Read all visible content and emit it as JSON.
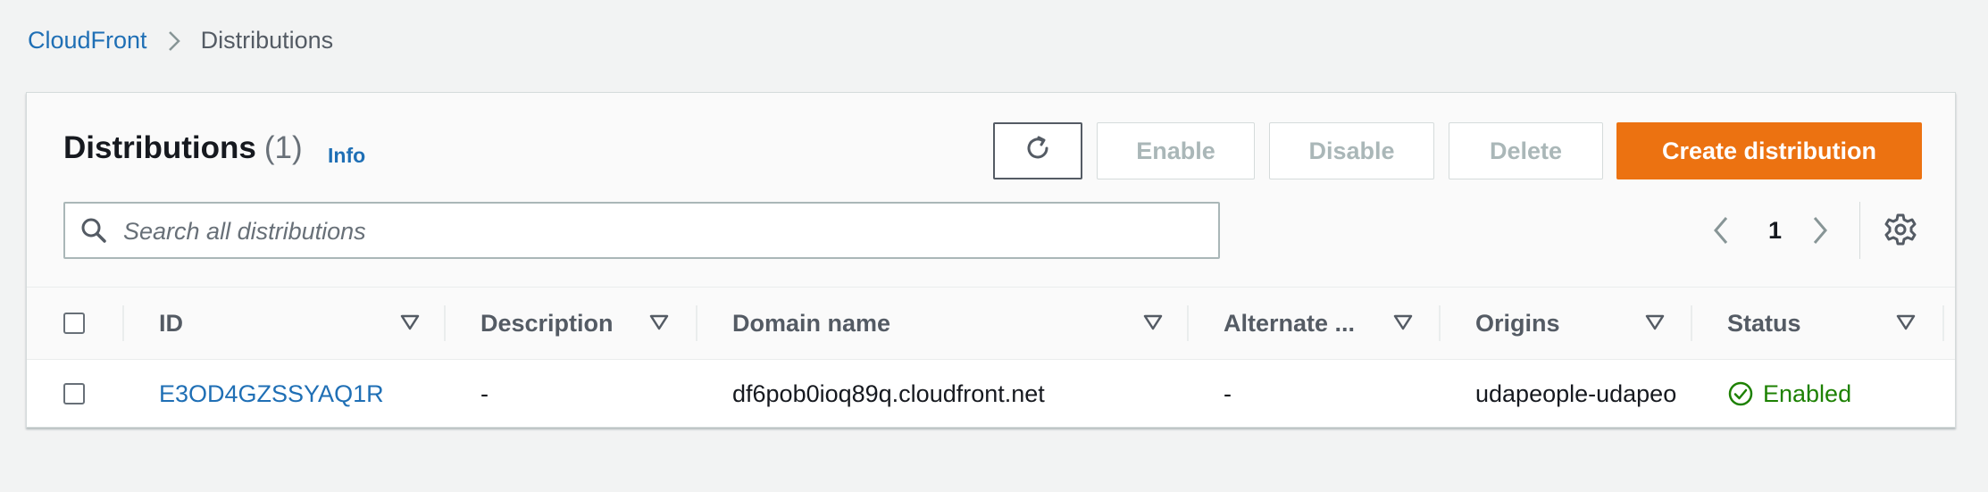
{
  "breadcrumb": {
    "root": "CloudFront",
    "current": "Distributions"
  },
  "header": {
    "title": "Distributions",
    "count": "(1)",
    "info": "Info"
  },
  "actions": {
    "enable": "Enable",
    "disable": "Disable",
    "delete": "Delete",
    "create": "Create distribution"
  },
  "search": {
    "placeholder": "Search all distributions",
    "value": ""
  },
  "pagination": {
    "current_page": "1"
  },
  "table": {
    "columns": [
      "ID",
      "Description",
      "Domain name",
      "Alternate ...",
      "Origins",
      "Status"
    ],
    "rows": [
      {
        "id": "E3OD4GZSSYAQ1R",
        "description": "-",
        "domain": "df6pob0ioq89q.cloudfront.net",
        "alternate": "-",
        "origins": "udapeople-udapeo",
        "status": "Enabled"
      }
    ]
  },
  "colors": {
    "link": "#1f6fb5",
    "primary": "#ec7211",
    "success": "#1d8102",
    "disabled_text": "#aab7b8"
  },
  "icons": {
    "breadcrumb_separator": "chevron-right-icon",
    "refresh": "refresh-icon",
    "search": "search-icon",
    "prev": "chevron-left-icon",
    "next": "chevron-right-icon",
    "settings": "gear-icon",
    "sort": "sort-down-icon",
    "status": "check-circle-icon"
  }
}
